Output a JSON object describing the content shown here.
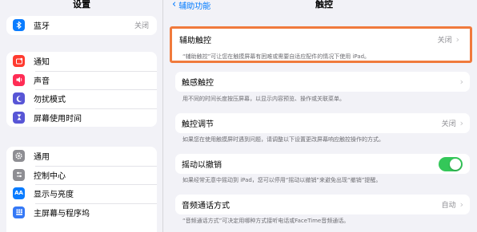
{
  "sidebar": {
    "title": "设置",
    "group1": [
      {
        "label": "蓝牙",
        "value": "关闭",
        "icon": "bluetooth-icon",
        "color": "#0a7cff"
      }
    ],
    "group2": [
      {
        "label": "通知",
        "icon": "notification-icon",
        "color": "#ff3b30"
      },
      {
        "label": "声音",
        "icon": "sound-icon",
        "color": "#ff2d55"
      },
      {
        "label": "勿扰模式",
        "icon": "moon-icon",
        "color": "#5856d6"
      },
      {
        "label": "屏幕使用时间",
        "icon": "hourglass-icon",
        "color": "#5856d6"
      }
    ],
    "group3": [
      {
        "label": "通用",
        "icon": "gear-icon",
        "color": "#8e8e93"
      },
      {
        "label": "控制中心",
        "icon": "control-center-icon",
        "color": "#8e8e93"
      },
      {
        "label": "显示与亮度",
        "icon": "display-brightness-icon",
        "color": "#0a7cff"
      },
      {
        "label": "主屏幕与程序坞",
        "icon": "home-screen-icon",
        "color": "#3478f6"
      }
    ]
  },
  "nav": {
    "back_label": "辅助功能",
    "title": "触控"
  },
  "settings": [
    {
      "label": "辅助触控",
      "value": "关闭",
      "desc": "“辅助触控”可让您在触摸屏幕有困难或需要自适应配件的情况下使用 iPad。"
    },
    {
      "label": "触感触控",
      "value": "",
      "desc": "用不同的时间长度按压屏幕，以显示内容预览、操作或关联菜单。"
    },
    {
      "label": "触控调节",
      "value": "关闭",
      "desc": "如果您在使用触摸屏时遇到问题，请调整以下设置更改屏幕响应触控操作的方式。"
    },
    {
      "label": "摇动以撤销",
      "value": "",
      "desc": "如果经常无意中摇动到 iPad，您可以停用“摇动以撤销”来避免出现“撤销”提醒。"
    },
    {
      "label": "音频通话方式",
      "value": "自动",
      "desc": "“音频通话方式”可决定用哪种方式接听电话或FaceTime音频通话。"
    }
  ],
  "colors": {
    "accent": "#007aff",
    "toggle_on": "#34c759",
    "highlight": "#f07a3c"
  }
}
